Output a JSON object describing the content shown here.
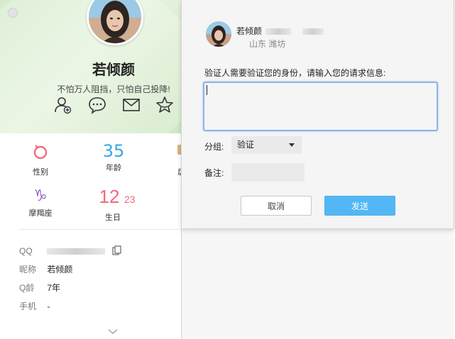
{
  "profile": {
    "nickname": "若倾颜",
    "motto": "不怕万人阻挡，只怕自己投降!",
    "attributes": [
      {
        "glyph": "♀",
        "label": "性别",
        "color": "#f36b7e"
      },
      {
        "glyph": "35",
        "label": "年龄",
        "color": "#3aa6e8"
      },
      {
        "glyph": "♑",
        "label": "摩羯座",
        "color": "#9a67c8"
      },
      {
        "glyph": "12",
        "glyph2": "23",
        "label": "生日",
        "color": "#f06a7a"
      }
    ],
    "partial_attr_label": "扂",
    "info": [
      {
        "key": "QQ",
        "value": ""
      },
      {
        "key": "昵称",
        "value": "若倾颜"
      },
      {
        "key": "Q龄",
        "value": "7年"
      },
      {
        "key": "手机",
        "value": "-"
      }
    ],
    "icons": {
      "add_friend": "add-friend-icon",
      "message": "chat-bubble-icon",
      "mail": "mail-icon",
      "favorite": "star-icon",
      "copy": "copy-icon",
      "expand": "chevron-down-icon"
    }
  },
  "dialog": {
    "name": "若倾颜",
    "location": "山东  潍坊",
    "prompt": "验证人需要验证您的身份，请输入您的请求信息:",
    "request_value": "",
    "group_label": "分组:",
    "group_value": "验证",
    "remark_label": "备注:",
    "remark_value": "",
    "cancel_label": "取消",
    "send_label": "发送"
  },
  "colors": {
    "accent": "#53b7f5",
    "focus_border": "#8fb3e8",
    "header_green": "#d5eccd"
  }
}
